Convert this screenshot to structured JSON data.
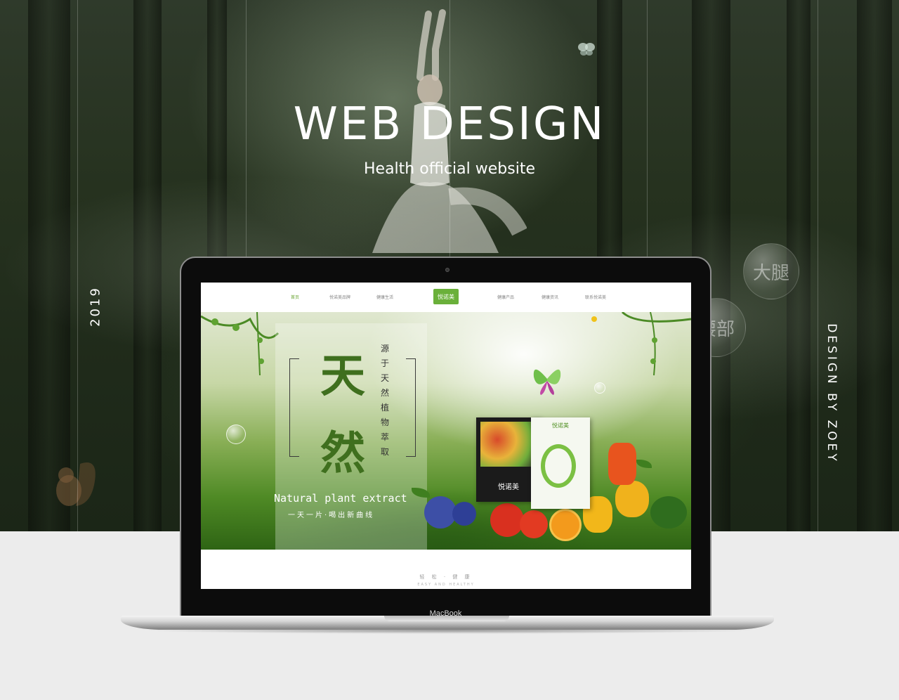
{
  "hero": {
    "title": "WEB DESIGN",
    "subtitle": "Health official website",
    "year": "2019",
    "byline": "DESIGN BY ZOEY",
    "bubble_words": [
      "大腿",
      "腰部"
    ]
  },
  "device": {
    "brand": "MacBook"
  },
  "site": {
    "nav": {
      "items": [
        "首页",
        "悦诺美品牌",
        "健康生活",
        "健康产品",
        "健康资讯",
        "联系悦诺美"
      ],
      "active_index": 0,
      "logo_text": "悦诺美"
    },
    "banner": {
      "big_char_1": "天",
      "big_char_2": "然",
      "vertical_text": "源于天然植物萃取",
      "headline_en": "Natural plant extract",
      "slogan": "一天一片·喝出新曲线",
      "product_brand": "悦诺美"
    },
    "tagline": {
      "cn": "轻 松 · 健 康",
      "en": "EASY AND HEALTHY"
    }
  },
  "colors": {
    "accent_green": "#6ab03a",
    "hero_dark": "#26321f",
    "page_bg": "#ececec"
  }
}
